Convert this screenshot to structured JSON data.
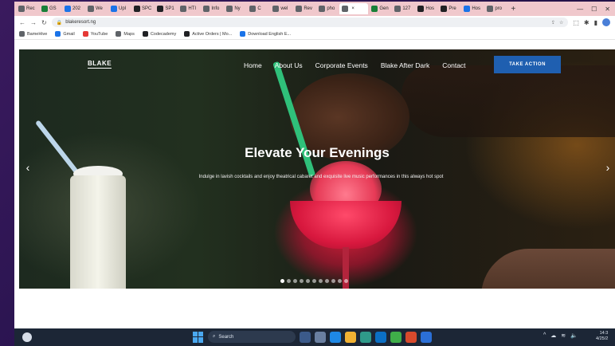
{
  "browser": {
    "tabs": [
      {
        "label": "Rec",
        "color": "#5f6368"
      },
      {
        "label": "GS",
        "color": "#188038"
      },
      {
        "label": "202",
        "color": "#1a73e8"
      },
      {
        "label": "We",
        "color": "#5f6368"
      },
      {
        "label": "Upl",
        "color": "#1a73e8"
      },
      {
        "label": "SPC",
        "color": "#202124"
      },
      {
        "label": "SP1",
        "color": "#202124"
      },
      {
        "label": "HTI",
        "color": "#5f6368"
      },
      {
        "label": "Info",
        "color": "#5f6368"
      },
      {
        "label": "Ny",
        "color": "#5f6368"
      },
      {
        "label": "C",
        "color": "#5f6368"
      },
      {
        "label": "wel",
        "color": "#5f6368"
      },
      {
        "label": "Rev",
        "color": "#5f6368"
      },
      {
        "label": "pho",
        "color": "#5f6368"
      },
      {
        "label": "",
        "color": "#5f6368",
        "active": true
      },
      {
        "label": "Gen",
        "color": "#188038"
      },
      {
        "label": "127",
        "color": "#5f6368"
      },
      {
        "label": "Hos",
        "color": "#202124"
      },
      {
        "label": "Pre",
        "color": "#202124"
      },
      {
        "label": "Hos",
        "color": "#1a73e8"
      },
      {
        "label": "pro",
        "color": "#5f6368"
      }
    ],
    "url": "blakeresort.ng",
    "bookmarks": [
      {
        "label": "BameHive",
        "color": "#5f6368"
      },
      {
        "label": "Gmail",
        "color": "#1a73e8"
      },
      {
        "label": "YouTube",
        "color": "#e53935"
      },
      {
        "label": "Maps",
        "color": "#5f6368"
      },
      {
        "label": "Codecademy",
        "color": "#202124"
      },
      {
        "label": "Active Orders | Mo...",
        "color": "#202124"
      },
      {
        "label": "Download English E...",
        "color": "#1a73e8"
      }
    ]
  },
  "site": {
    "logo": "BLAKE",
    "menu": [
      "Home",
      "About Us",
      "Corporate Events",
      "Blake After Dark",
      "Contact"
    ],
    "cta": "TAKE ACTION",
    "hero": {
      "title": "Elevate Your Evenings",
      "subtitle": "Indulge in lavish cocktails and enjoy theatrical cabaret and exquisite live music performances in this always hot spot",
      "slide_count": 11,
      "active_slide": 0
    }
  },
  "taskbar": {
    "search_label": "Search",
    "clock_time": "14:3",
    "clock_date": "4/25/2"
  }
}
